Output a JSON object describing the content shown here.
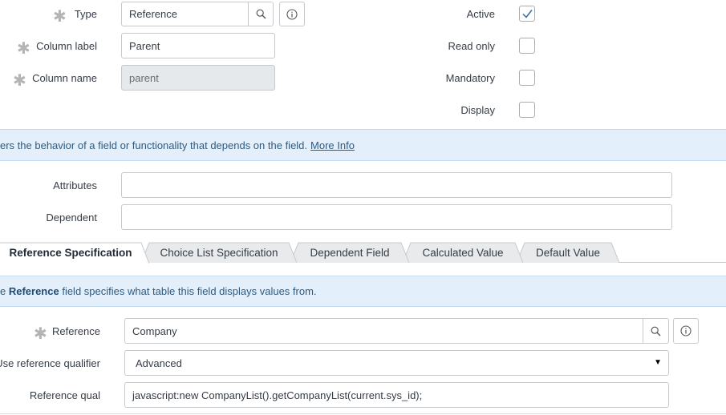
{
  "fields": {
    "type": {
      "label": "Type",
      "value": "Reference"
    },
    "column_label": {
      "label": "Column label",
      "value": "Parent"
    },
    "column_name": {
      "label": "Column name",
      "value": "parent"
    },
    "active": {
      "label": "Active",
      "checked": true
    },
    "read_only": {
      "label": "Read only",
      "checked": false
    },
    "mandatory": {
      "label": "Mandatory",
      "checked": false
    },
    "display": {
      "label": "Display",
      "checked": false
    },
    "attributes": {
      "label": "Attributes",
      "value": ""
    },
    "dependent": {
      "label": "Dependent",
      "value": ""
    }
  },
  "info_banner": {
    "text": "ers the behavior of a field or functionality that depends on the field.",
    "link": "More Info"
  },
  "tabs": [
    {
      "label": "Reference Specification",
      "active": true
    },
    {
      "label": "Choice List Specification",
      "active": false
    },
    {
      "label": "Dependent Field",
      "active": false
    },
    {
      "label": "Calculated Value",
      "active": false
    },
    {
      "label": "Default Value",
      "active": false
    }
  ],
  "ref_banner": {
    "prefix": "e ",
    "bold": "Reference",
    "suffix": " field specifies what table this field displays values from."
  },
  "reference_section": {
    "reference": {
      "label": "Reference",
      "value": "Company"
    },
    "qualifier": {
      "label": "Use reference qualifier",
      "value": "Advanced"
    },
    "reference_qual": {
      "label": "Reference qual",
      "value": "javascript:new CompanyList().getCompanyList(current.sys_id);"
    }
  },
  "icons": {
    "lookup": "magnifier-icon",
    "info": "info-circle-icon",
    "required": "asterisk-icon",
    "check": "checkmark-icon",
    "dropdown": "caret-down-icon"
  },
  "colors": {
    "banner_bg": "#e3f0fb",
    "banner_text": "#2e5b82",
    "check": "#2f6da3"
  }
}
